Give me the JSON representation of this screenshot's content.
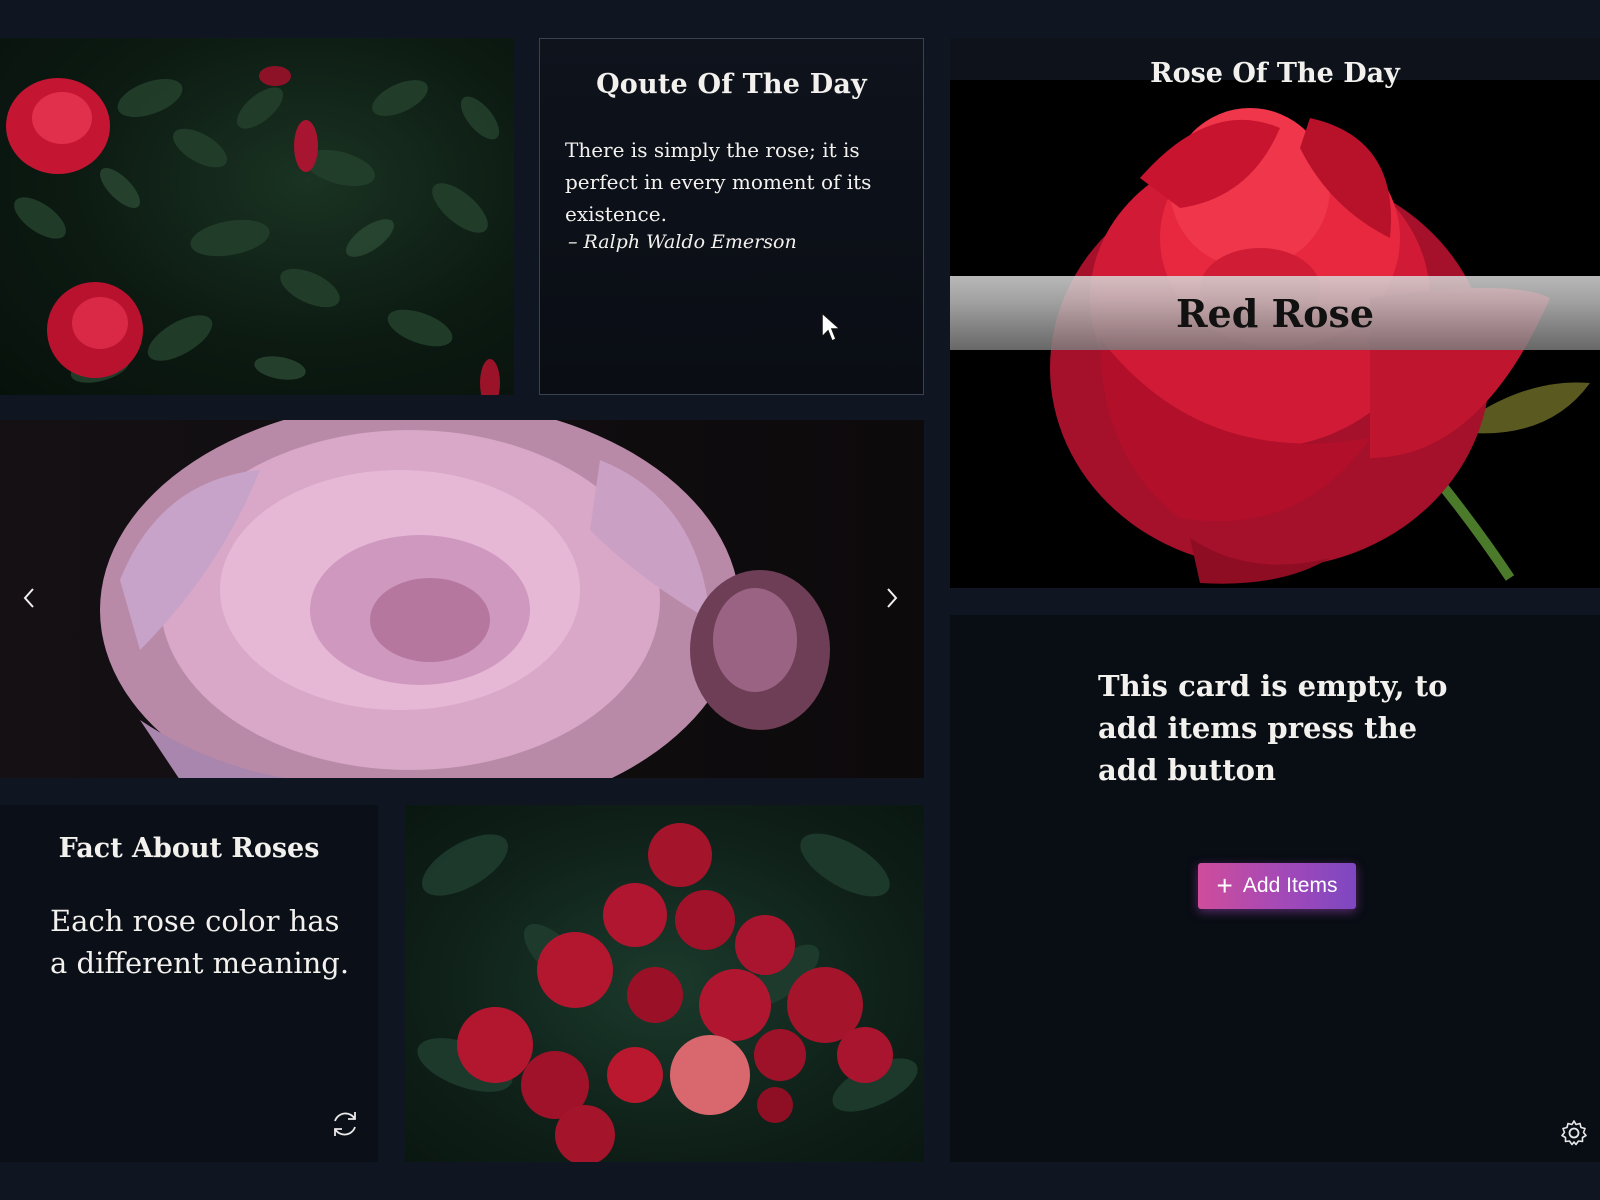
{
  "quote_card": {
    "title": "Qoute Of The Day",
    "text": "There is simply the rose; it is perfect in every moment of its existence.",
    "author": "– Ralph Waldo Emerson"
  },
  "rose_of_day": {
    "title": "Rose Of The Day",
    "name": "Red Rose"
  },
  "fact_card": {
    "title": "Fact About Roses",
    "text": "Each rose color has a different meaning."
  },
  "empty_card": {
    "message": "This card is empty, to add items press the add button",
    "add_button_label": "Add Items"
  },
  "icons": {
    "carousel_prev": "chevron-left-icon",
    "carousel_next": "chevron-right-icon",
    "refresh": "refresh-icon",
    "settings": "gear-icon",
    "add": "plus-icon"
  },
  "colors": {
    "background": "#0f1621",
    "card": "#0b0f17",
    "button_gradient_start": "#cf4d9b",
    "button_gradient_end": "#7d47c1"
  }
}
